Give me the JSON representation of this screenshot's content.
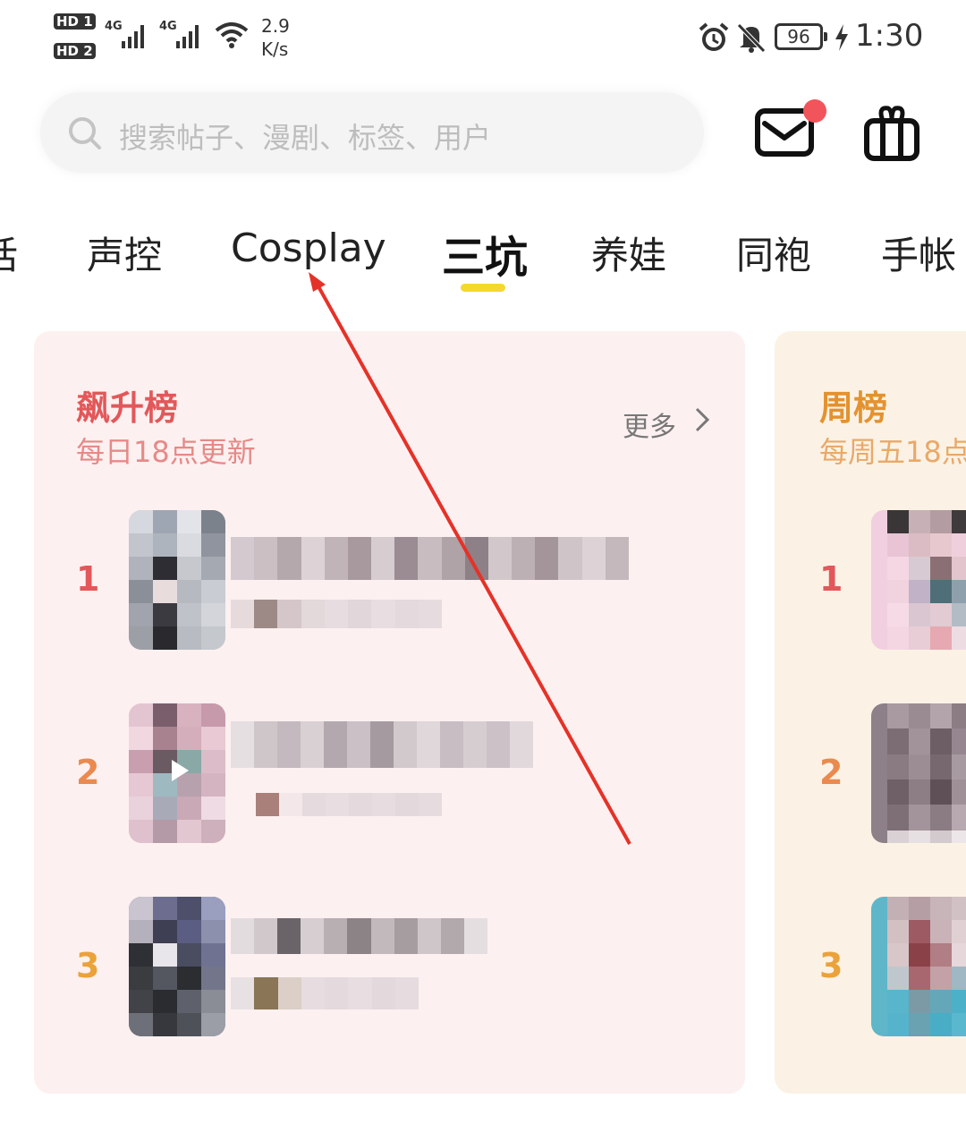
{
  "status_bar": {
    "sim1": "HD 1",
    "sim2": "HD 2",
    "net1": "4G",
    "net2": "4G",
    "speed_value": "2.9",
    "speed_unit": "K/s",
    "battery": "96",
    "time": "1:30"
  },
  "header": {
    "search_placeholder": "搜索帖子、漫剧、标签、用户"
  },
  "tabs": [
    {
      "label": "话"
    },
    {
      "label": "声控"
    },
    {
      "label": "Cosplay"
    },
    {
      "label": "三坑"
    },
    {
      "label": "养娃"
    },
    {
      "label": "同袍"
    },
    {
      "label": "手帐"
    }
  ],
  "active_tab": "三坑",
  "cards": [
    {
      "title": "飙升榜",
      "subtitle": "每日18点更新",
      "more_label": "更多",
      "ranks": [
        "1",
        "2",
        "3"
      ]
    },
    {
      "title": "周榜",
      "subtitle": "每周五18点",
      "ranks": [
        "1",
        "2",
        "3"
      ]
    }
  ],
  "colors": {
    "accent_yellow": "#f4d82f",
    "notification_dot": "#f2545b",
    "annotation_arrow": "#e53228",
    "card1_bg": "#fdf0f0",
    "card2_bg": "#fbf2e5"
  },
  "icons": [
    "search-icon",
    "mail-icon",
    "gift-icon",
    "chevron-right-icon",
    "alarm-icon",
    "mute-icon",
    "wifi-icon",
    "charging-icon"
  ]
}
